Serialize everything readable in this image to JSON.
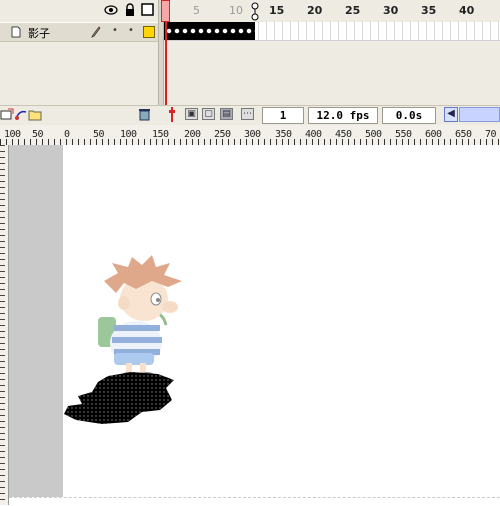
{
  "timeline": {
    "frame_numbers": [
      "5",
      "10",
      "15",
      "20",
      "25",
      "30",
      "35",
      "40"
    ],
    "layer": {
      "name": "影子",
      "pencil_icon": "pencil-icon",
      "dots": [
        "•",
        "•"
      ]
    },
    "header_icons": [
      "eye-icon",
      "lock-icon",
      "outline-square-icon"
    ],
    "footer": {
      "current_frame": "1",
      "frame_rate": "12.0 fps",
      "elapsed_time": "0.0s"
    }
  },
  "ruler": {
    "labels": [
      "100",
      "50",
      "0",
      "50",
      "100",
      "150",
      "200",
      "250",
      "300",
      "350",
      "400",
      "450",
      "500",
      "550",
      "600",
      "650",
      "70"
    ]
  },
  "stage": {
    "character": "boy-cartoon-faded",
    "shadow": "black-shadow-shape"
  },
  "colors": {
    "keyframe": "#000000",
    "playhead": "#e02020",
    "pasteboard": "#c9c9c9",
    "layer_color_swatch": "#ffd700"
  }
}
